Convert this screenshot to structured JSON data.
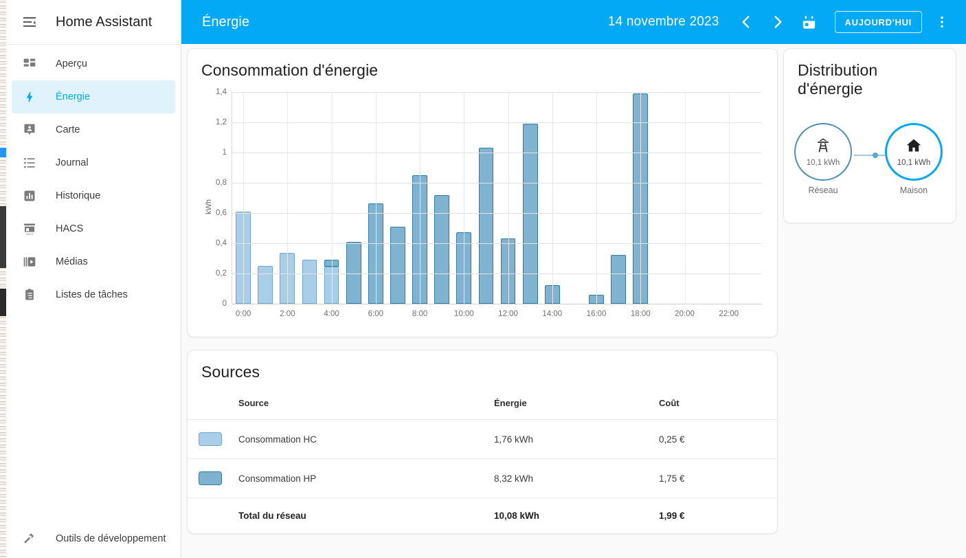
{
  "sidebar": {
    "title": "Home Assistant",
    "menu_icon": "hamburger-collapse-icon",
    "items": [
      {
        "label": "Aperçu",
        "icon": "view-dashboard-icon",
        "active": false
      },
      {
        "label": "Énergie",
        "icon": "lightning-bolt-icon",
        "active": true
      },
      {
        "label": "Carte",
        "icon": "map-marker-account-icon",
        "active": false
      },
      {
        "label": "Journal",
        "icon": "format-list-bulleted-icon",
        "active": false
      },
      {
        "label": "Historique",
        "icon": "chart-box-icon",
        "active": false
      },
      {
        "label": "HACS",
        "icon": "hacs-store-icon",
        "active": false
      },
      {
        "label": "Médias",
        "icon": "play-box-multiple-icon",
        "active": false
      },
      {
        "label": "Listes de tâches",
        "icon": "clipboard-list-icon",
        "active": false
      }
    ],
    "footer_items": [
      {
        "label": "Outils de développement",
        "icon": "hammer-icon"
      }
    ]
  },
  "toolbar": {
    "title": "Énergie",
    "date": "14 novembre 2023",
    "prev_icon": "chevron-left-icon",
    "next_icon": "chevron-right-icon",
    "calendar_icon": "calendar-icon",
    "today_label": "AUJOURD'HUI",
    "overflow_icon": "dots-vertical-icon",
    "accent_color": "#03a9f4"
  },
  "energy_card": {
    "title": "Consommation d'énergie"
  },
  "chart_data": {
    "type": "bar",
    "title": "Consommation d'énergie",
    "xlabel": "",
    "ylabel": "kWh",
    "ylim": [
      0,
      1.4
    ],
    "yticks": [
      0,
      0.2,
      0.4,
      0.6,
      0.8,
      1,
      1.2,
      1.4
    ],
    "ytick_labels": [
      "0",
      "0,2",
      "0,4",
      "0,6",
      "0,8",
      "1",
      "1,2",
      "1,4"
    ],
    "xticks": [
      "0:00",
      "2:00",
      "4:00",
      "6:00",
      "8:00",
      "10:00",
      "12:00",
      "14:00",
      "16:00",
      "18:00",
      "20:00",
      "22:00"
    ],
    "grid": true,
    "stacked": true,
    "legend_position": "none",
    "categories": [
      "0:00",
      "1:00",
      "2:00",
      "3:00",
      "4:00",
      "5:00",
      "6:00",
      "7:00",
      "8:00",
      "9:00",
      "10:00",
      "11:00",
      "12:00",
      "13:00",
      "14:00",
      "15:00",
      "16:00",
      "17:00",
      "18:00",
      "19:00",
      "20:00",
      "21:00",
      "22:00",
      "23:00"
    ],
    "series": [
      {
        "name": "Consommation HC",
        "color": "#a9cee9",
        "border": "#6fa6cc",
        "values": [
          0.61,
          0.25,
          0.335,
          0.29,
          0.245,
          0,
          0,
          0,
          0,
          0,
          0,
          0,
          0,
          0,
          0,
          0,
          0,
          0,
          0,
          0,
          0,
          0,
          0,
          0
        ]
      },
      {
        "name": "Consommation HP",
        "color": "#80b3cf",
        "border": "#2b7ca8",
        "values": [
          0,
          0,
          0,
          0,
          0.047,
          0.41,
          0.665,
          0.51,
          0.85,
          0.72,
          0.475,
          1.03,
          0.43,
          1.19,
          0.125,
          0,
          0.06,
          0.325,
          1.39,
          0,
          0,
          0,
          0,
          0
        ]
      }
    ]
  },
  "sources_card": {
    "title": "Sources",
    "columns": [
      "Source",
      "Énergie",
      "Coût"
    ],
    "rows": [
      {
        "swatch": "hc",
        "source": "Consommation HC",
        "energy": "1,76 kWh",
        "cost": "0,25 €"
      },
      {
        "swatch": "hp",
        "source": "Consommation HP",
        "energy": "8,32 kWh",
        "cost": "1,75 €"
      }
    ],
    "total": {
      "source": "Total du réseau",
      "energy": "10,08 kWh",
      "cost": "1,99 €"
    }
  },
  "distribution_card": {
    "title": "Distribution d'énergie",
    "nodes": [
      {
        "id": "grid",
        "icon": "transmission-tower-icon",
        "value": "10,1 kWh",
        "name": "Réseau",
        "color": "#4b90b6"
      },
      {
        "id": "home",
        "icon": "home-icon",
        "value": "10,1 kWh",
        "name": "Maison",
        "color": "#03a9f4"
      }
    ]
  }
}
